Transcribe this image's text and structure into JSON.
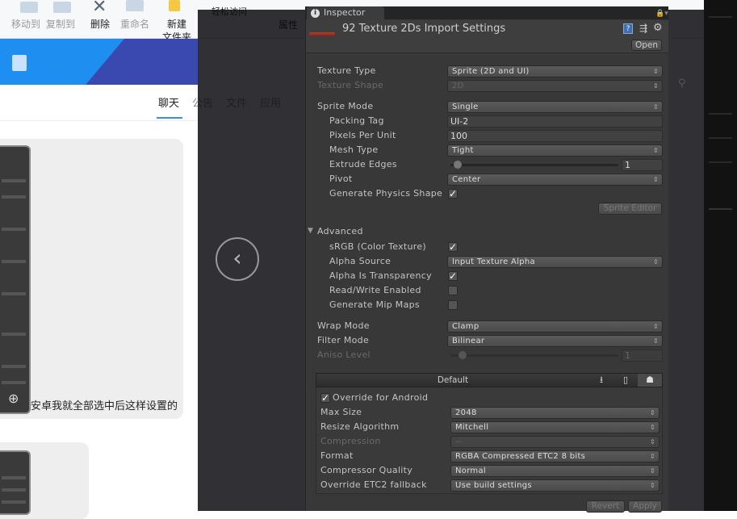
{
  "explorer": {
    "ribbon": [
      "移动到",
      "复制到",
      "删除",
      "重命名",
      "新建",
      "文件夹",
      "轻松访问",
      "属性"
    ]
  },
  "chat": {
    "tabs": [
      "聊天",
      "公告",
      "文件",
      "应用"
    ],
    "active_tab": "聊天",
    "message": "安卓我就全部选中后这样设置的"
  },
  "viewer": {
    "prev_icon": "chevron-left-icon",
    "prev_glyph": "‹"
  },
  "inspector": {
    "tab_label": "Inspector",
    "title": "92 Texture 2Ds Import Settings",
    "open_label": "Open",
    "sprite_editor_label": "Sprite Editor",
    "advanced_label": "Advanced",
    "rows": [
      {
        "label": "Texture Type",
        "control": "dropdown",
        "value": "Sprite (2D and UI)"
      },
      {
        "label": "Texture Shape",
        "control": "dropdown",
        "value": "2D",
        "disabled": true
      },
      {
        "label": "Sprite Mode",
        "control": "dropdown",
        "value": "Single"
      },
      {
        "label": "Packing Tag",
        "control": "text",
        "value": "UI-2"
      },
      {
        "label": "Pixels Per Unit",
        "control": "text",
        "value": "100"
      },
      {
        "label": "Mesh Type",
        "control": "dropdown",
        "value": "Tight"
      },
      {
        "label": "Extrude Edges",
        "control": "slider",
        "value": "1",
        "fraction": 0.03
      },
      {
        "label": "Pivot",
        "control": "dropdown",
        "value": "Center"
      },
      {
        "label": "Generate Physics Shape",
        "control": "checkbox",
        "checked": true
      },
      {
        "label": "sRGB (Color Texture)",
        "control": "checkbox",
        "checked": true
      },
      {
        "label": "Alpha Source",
        "control": "dropdown",
        "value": "Input Texture Alpha"
      },
      {
        "label": "Alpha Is Transparency",
        "control": "checkbox",
        "checked": true
      },
      {
        "label": "Read/Write Enabled",
        "control": "checkbox",
        "checked": false
      },
      {
        "label": "Generate Mip Maps",
        "control": "checkbox",
        "checked": false
      },
      {
        "label": "Wrap Mode",
        "control": "dropdown",
        "value": "Clamp"
      },
      {
        "label": "Filter Mode",
        "control": "dropdown",
        "value": "Bilinear"
      },
      {
        "label": "Aniso Level",
        "control": "slider",
        "value": "1",
        "fraction": 0.06,
        "disabled": true
      }
    ],
    "platform": {
      "tab_label": "Default",
      "tabs": [
        "download-icon",
        "mobile-icon",
        "android-icon"
      ],
      "active_tab": "android-icon",
      "override_label": "Override for Android",
      "override_checked": true,
      "rows": [
        {
          "label": "Max Size",
          "value": "2048"
        },
        {
          "label": "Resize Algorithm",
          "value": "Mitchell"
        },
        {
          "label": "Compression",
          "value": "--",
          "disabled": true
        },
        {
          "label": "Format",
          "value": "RGBA Compressed ETC2 8 bits"
        },
        {
          "label": "Compressor Quality",
          "value": "Normal"
        },
        {
          "label": "Override ETC2 fallback",
          "value": "Use build settings"
        }
      ]
    },
    "revert_label": "Revert",
    "apply_label": "Apply"
  }
}
